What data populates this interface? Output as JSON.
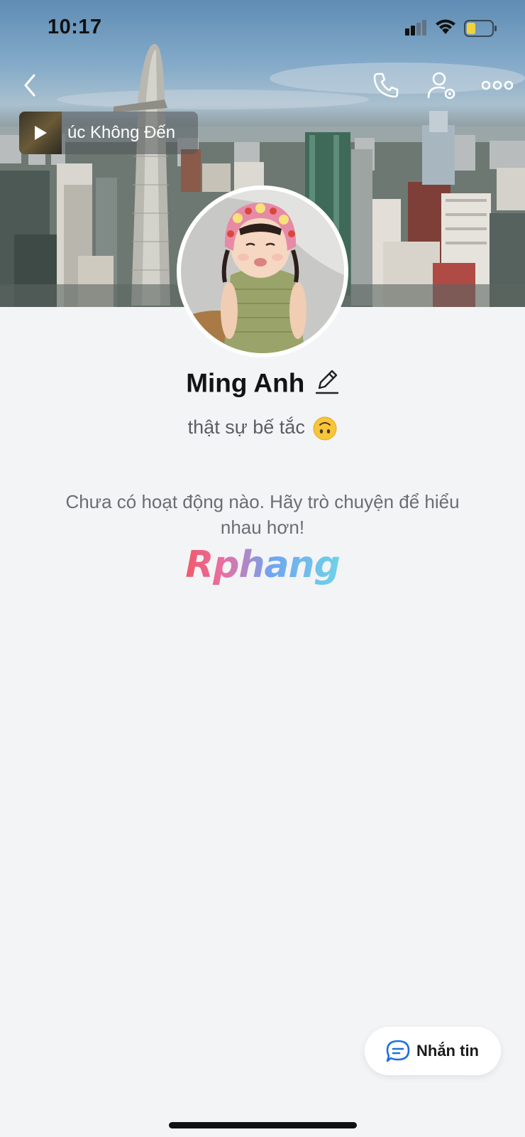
{
  "status_bar": {
    "time": "10:17"
  },
  "nav": {
    "back_icon": "chevron-left-icon",
    "call_icon": "phone-icon",
    "settings_icon": "person-settings-icon",
    "more_icon": "ellipsis-icon"
  },
  "music": {
    "title": "úc Không Đến"
  },
  "profile": {
    "name": "Ming Anh",
    "status": "thật sự bế tắc",
    "status_emoji": "upside-down-face-emoji"
  },
  "activity": {
    "empty_message": "Chưa có hoạt động nào. Hãy trò chuyện để hiểu nhau hơn!"
  },
  "watermark": {
    "text": "Rphang"
  },
  "actions": {
    "message_label": "Nhắn tin"
  },
  "colors": {
    "background": "#f3f4f6",
    "accent_blue": "#1e6fe0",
    "battery_yellow": "#f2d23a"
  }
}
